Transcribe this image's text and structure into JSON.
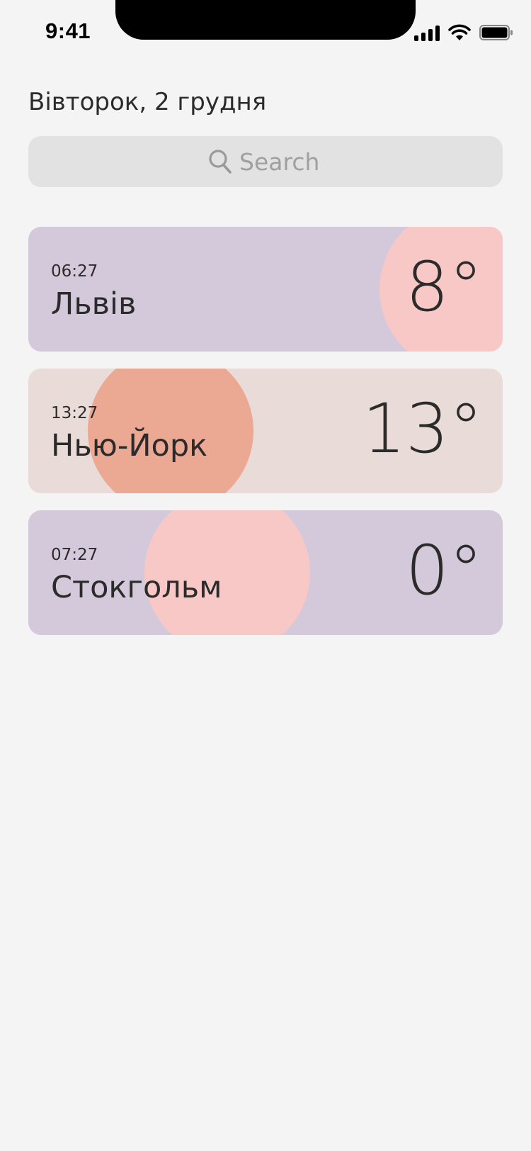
{
  "status_bar": {
    "time": "9:41",
    "icons": [
      "cellular-signal-icon",
      "wifi-icon",
      "battery-icon"
    ]
  },
  "header": {
    "date": "Вівторок, 2 грудня"
  },
  "search": {
    "placeholder": "Search",
    "icon": "search-icon"
  },
  "cities": [
    {
      "time": "06:27",
      "name": "Львів",
      "temp": "8°",
      "bg": "#d4c9da",
      "circle": "#f8c8c6"
    },
    {
      "time": "13:27",
      "name": "Нью-Йорк",
      "temp": "13°",
      "bg": "#e9dbd7",
      "circle": "#eba893"
    },
    {
      "time": "07:27",
      "name": "Стокгольм",
      "temp": "0°",
      "bg": "#d4c9da",
      "circle": "#f8c8c6"
    }
  ]
}
